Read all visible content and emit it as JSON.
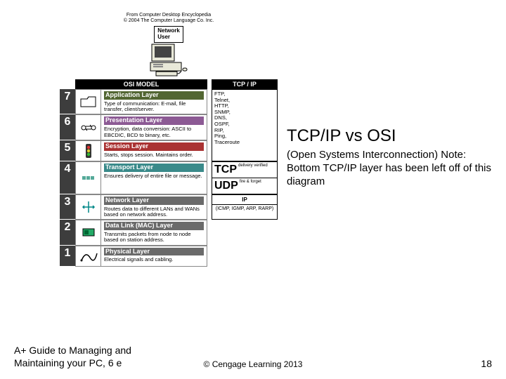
{
  "attribution": {
    "line1": "From Computer Desktop Encyclopedia",
    "line2": "© 2004 The Computer Language Co. Inc."
  },
  "computer_label": "Network\nUser",
  "headers": {
    "osi": "OSI MODEL",
    "tcpip": "TCP / IP"
  },
  "osi": [
    {
      "num": "7",
      "color": "c7",
      "title": "Application Layer",
      "desc": "Type of communication: E-mail, file transfer, client/server.",
      "icon": "folder-icon"
    },
    {
      "num": "6",
      "color": "c6",
      "title": "Presentation Layer",
      "desc": "Encryption, data conversion: ASCII to EBCDIC, BCD to binary, etc.",
      "icon": "convert-icon"
    },
    {
      "num": "5",
      "color": "c5",
      "title": "Session Layer",
      "desc": "Starts, stops session. Maintains order.",
      "icon": "traffic-light-icon"
    },
    {
      "num": "4",
      "color": "c4",
      "title": "Transport Layer",
      "desc": "Ensures delivery of entire file or message.",
      "icon": "blocks-icon"
    },
    {
      "num": "3",
      "color": "c3",
      "title": "Network Layer",
      "desc": "Routes data to different LANs and WANs based on network address.",
      "icon": "routes-icon"
    },
    {
      "num": "2",
      "color": "c2",
      "title": "Data Link (MAC) Layer",
      "desc": "Transmits packets from node to node based on station address.",
      "icon": "nic-icon"
    },
    {
      "num": "1",
      "color": "c1",
      "title": "Physical Layer",
      "desc": "Electrical signals and cabling.",
      "icon": "cable-icon"
    }
  ],
  "tcpip": {
    "app": "FTP,\nTelnet,\nHTTP,\nSNMP,\nDNS,\nOSPF,\nRIP,\nPing,\nTraceroute",
    "tcp_label": "TCP",
    "tcp_desc": "delivery verified",
    "udp_label": "UDP",
    "udp_desc": "fire & forget",
    "ip_label": "IP",
    "subnet": "(ICMP, IGMP, ARP, RARP)"
  },
  "right": {
    "title": "TCP/IP vs OSI",
    "sub": "(Open Systems Interconnection) Note: Bottom TCP/IP layer has been left off of this diagram"
  },
  "footer": {
    "left": "A+ Guide to Managing and Maintaining your PC, 6 e",
    "mid": "© Cengage Learning  2013",
    "right": "18"
  }
}
